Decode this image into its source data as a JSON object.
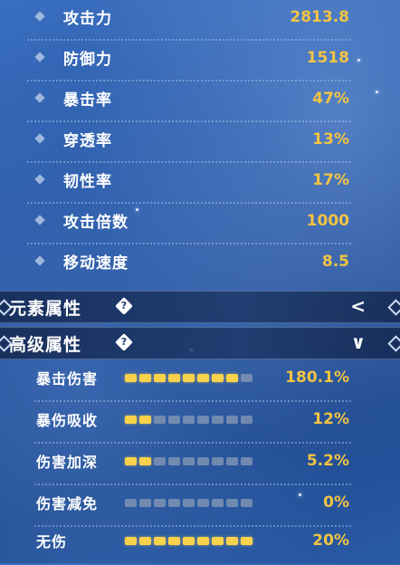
{
  "basic_stats": [
    {
      "label": "攻击力",
      "value": "2813.8"
    },
    {
      "label": "防御力",
      "value": "1518"
    },
    {
      "label": "暴击率",
      "value": "47%"
    },
    {
      "label": "穿透率",
      "value": "13%"
    },
    {
      "label": "韧性率",
      "value": "17%"
    },
    {
      "label": "攻击倍数",
      "value": "1000"
    },
    {
      "label": "移动速度",
      "value": "8.5"
    }
  ],
  "sections": {
    "elemental": {
      "title": "元素属性",
      "help": "?",
      "arrow": "<"
    },
    "advanced": {
      "title": "高级属性",
      "help": "?",
      "arrow": "∨"
    }
  },
  "advanced_stats": [
    {
      "label": "暴击伤害",
      "value": "180.1%",
      "filled": 8,
      "total": 9
    },
    {
      "label": "暴伤吸收",
      "value": "12%",
      "filled": 2,
      "total": 9
    },
    {
      "label": "伤害加深",
      "value": "5.2%",
      "filled": 2,
      "total": 9
    },
    {
      "label": "伤害减免",
      "value": "0%",
      "filled": 0,
      "total": 9
    },
    {
      "label": "无伤",
      "value": "20%",
      "filled": 9,
      "total": 9
    }
  ],
  "colors": {
    "value": "#f3c443",
    "bar_on": "#f8d24a",
    "bar_off": "#8a9bb5"
  }
}
